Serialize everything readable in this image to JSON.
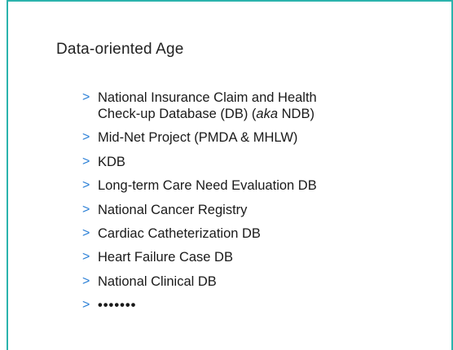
{
  "slide": {
    "title": "Data-oriented Age",
    "marker": ">",
    "items": [
      {
        "line1": "National Insurance Claim and Health",
        "line2_pre": "Check-up Database (DB) (",
        "line2_em": "aka",
        "line2_post": " NDB)"
      },
      {
        "text": "Mid-Net Project (PMDA & MHLW)"
      },
      {
        "text": "KDB"
      },
      {
        "text": "Long-term Care Need Evaluation DB"
      },
      {
        "text": "National Cancer Registry"
      },
      {
        "text": "Cardiac Catheterization DB"
      },
      {
        "text": "Heart Failure Case DB"
      },
      {
        "text": "National Clinical DB"
      },
      {
        "text": "•••••••"
      }
    ],
    "accent_color": "#2bb3ad",
    "marker_color": "#2a7fd6"
  }
}
